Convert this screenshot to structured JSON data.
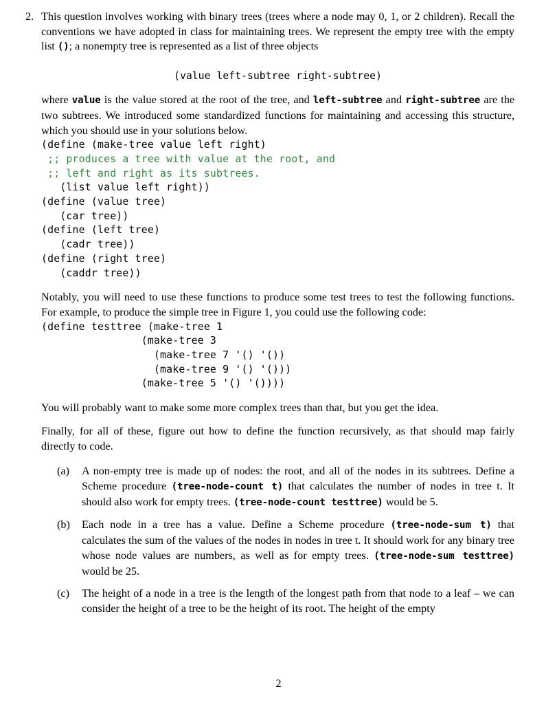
{
  "document": {
    "page_number": "2",
    "comment_color": "#2f8b3c",
    "text_color": "#000000",
    "background_color": "#ffffff"
  },
  "question": {
    "number": "2.",
    "intro_p1_a": "This question involves working with binary trees (trees where a node may 0, 1, or 2 children). Recall the conventions we have adopted in class for maintaining trees. We represent the empty tree with the empty list ",
    "intro_p1_code": "()",
    "intro_p1_b": "; a nonempty tree is represented as a list of three objects",
    "display_line": "(value left-subtree right-subtree)",
    "intro_p2_a": "where ",
    "intro_p2_code1": "value",
    "intro_p2_b": " is the value stored at the root of the tree, and ",
    "intro_p2_code2": "left-subtree",
    "intro_p2_c": " and ",
    "intro_p2_code3": "right-subtree",
    "intro_p2_d": " are the two subtrees. We introduced some standardized functions for maintaining and accessing this structure, which you should use in your solutions below.",
    "code_make_tree_l1": "(define (make-tree value left right)",
    "code_make_tree_c1": " ;; produces a tree with value at the root, and",
    "code_make_tree_c2": " ;; left and right as its subtrees.",
    "code_make_tree_l2": "   (list value left right))",
    "code_value_l1": "(define (value tree)",
    "code_value_l2": "   (car tree))",
    "code_left_l1": "(define (left tree)",
    "code_left_l2": "   (cadr tree))",
    "code_right_l1": "(define (right tree)",
    "code_right_l2": "   (caddr tree))",
    "notably_paragraph": "Notably, you will need to use these functions to produce some test trees to test the following functions. For example, to produce the simple tree in Figure 1, you could use the following code:",
    "code_testtree_l1": "(define testtree (make-tree 1",
    "code_testtree_l2": "                (make-tree 3",
    "code_testtree_l3": "                  (make-tree 7 '() '())",
    "code_testtree_l4": "                  (make-tree 9 '() '()))",
    "code_testtree_l5": "                (make-tree 5 '() '())))",
    "complex_paragraph": "You will probably want to make some more complex trees than that, but you get the idea.",
    "finally_paragraph": "Finally, for all of these, figure out how to define the function recursively, as that should map fairly directly to code."
  },
  "subitems": [
    {
      "letter": "(a)",
      "text_a": "A non-empty tree is made up of nodes: the root, and all of the nodes in its subtrees. Define a Scheme procedure ",
      "code1": "(tree-node-count t)",
      "text_b": " that calculates the number of nodes in tree t. It should also work for empty trees. ",
      "code2": "(tree-node-count testtree)",
      "text_c": " would be 5."
    },
    {
      "letter": "(b)",
      "text_a": "Each node in a tree has a value. Define a Scheme procedure ",
      "code1": "(tree-node-sum t)",
      "text_b": " that calculates the sum of the values of the nodes in nodes in tree t. It should work for any binary tree whose node values are numbers, as well as for empty trees. ",
      "code2": "(tree-node-sum testtree)",
      "text_c": " would be 25."
    },
    {
      "letter": "(c)",
      "text_a": "The height of a node in a tree is the length of the longest path from that node to a leaf – we can consider the height of a tree to be the height of its root. The height of the empty",
      "code1": "",
      "text_b": "",
      "code2": "",
      "text_c": ""
    }
  ]
}
